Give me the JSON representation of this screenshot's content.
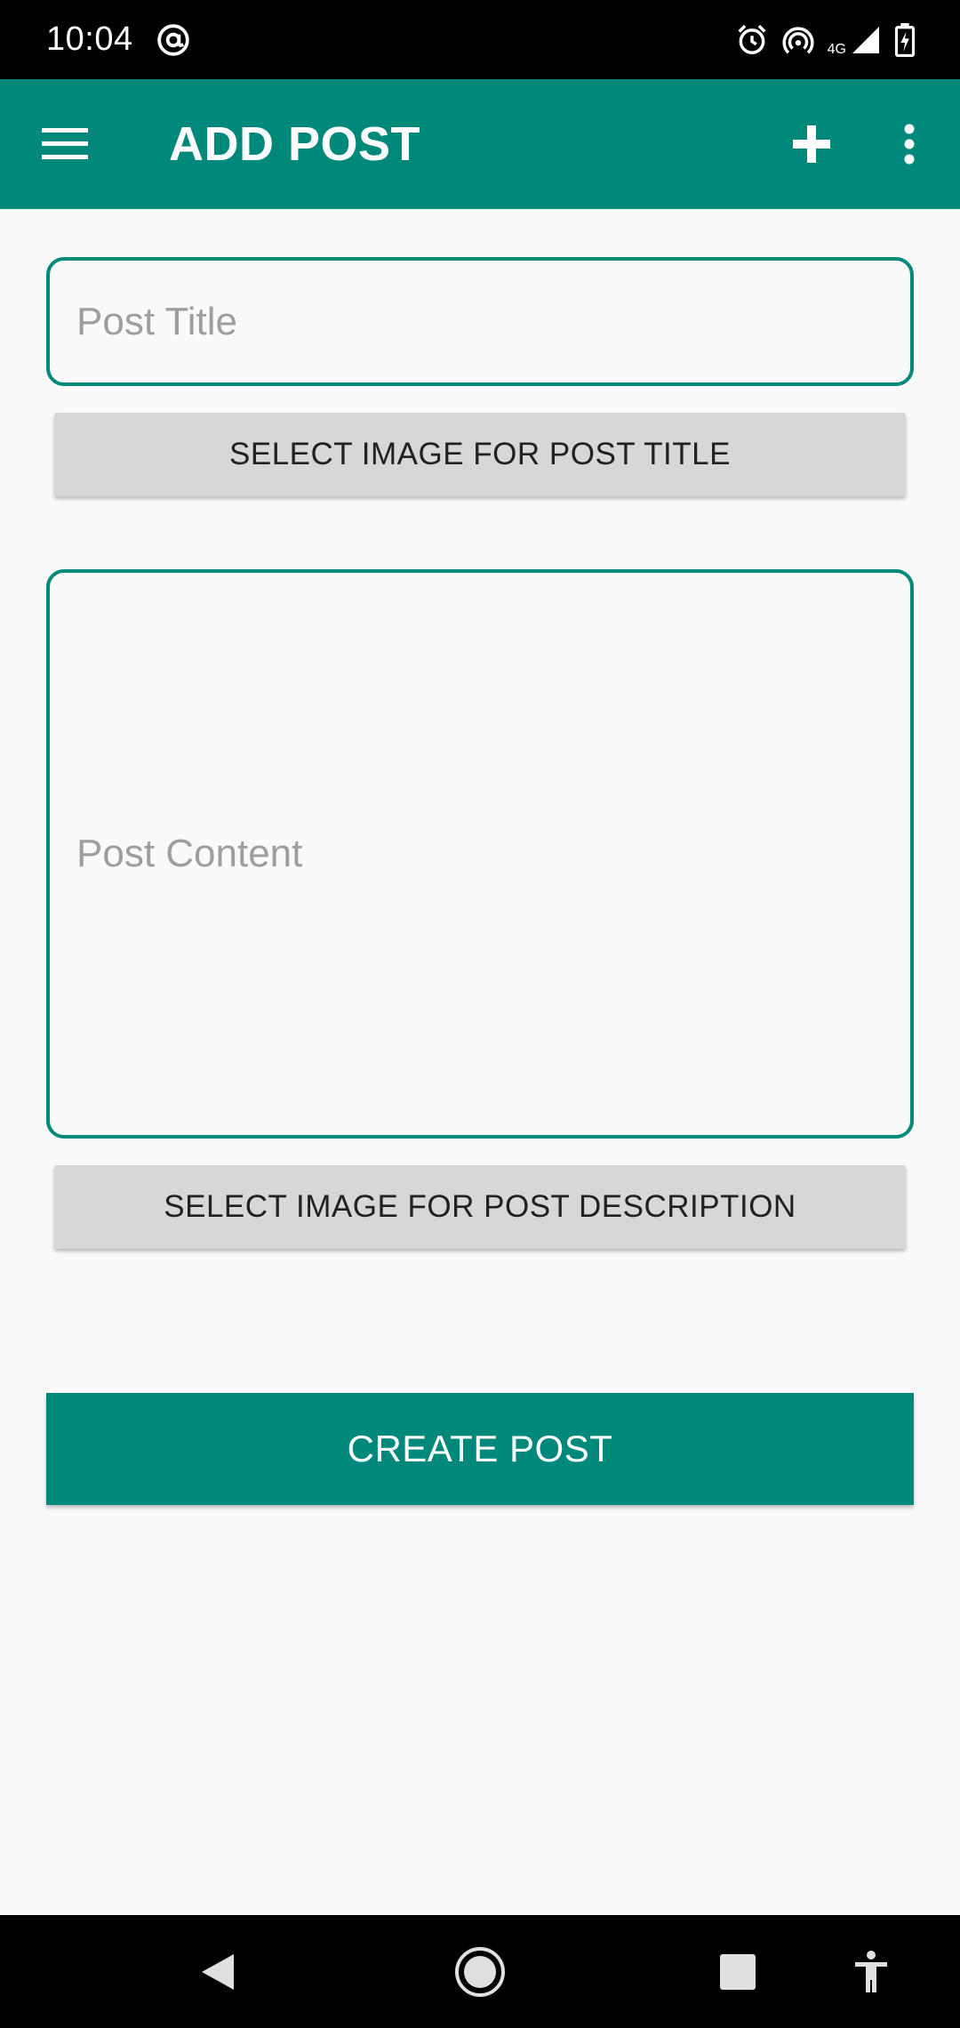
{
  "status_bar": {
    "time": "10:04",
    "network_label": "4G",
    "icons": [
      "at-sign-icon",
      "alarm-icon",
      "hotspot-icon",
      "signal-icon",
      "battery-charging-icon"
    ]
  },
  "app_bar": {
    "title": "ADD POST",
    "icons": [
      "menu-icon",
      "plus-icon",
      "more-vert-icon"
    ]
  },
  "form": {
    "title_placeholder": "Post Title",
    "title_value": "",
    "select_title_image_label": "SELECT IMAGE FOR POST TITLE",
    "content_placeholder": "Post Content",
    "content_value": "",
    "select_description_image_label": "SELECT IMAGE FOR POST DESCRIPTION",
    "create_label": "CREATE POST"
  },
  "nav_bar": {
    "icons": [
      "back-icon",
      "home-icon",
      "recents-icon",
      "accessibility-icon"
    ]
  },
  "colors": {
    "primary": "#00897b",
    "grey_button": "#d6d7d7",
    "placeholder": "#9e9e9e",
    "background": "#fafafa"
  }
}
